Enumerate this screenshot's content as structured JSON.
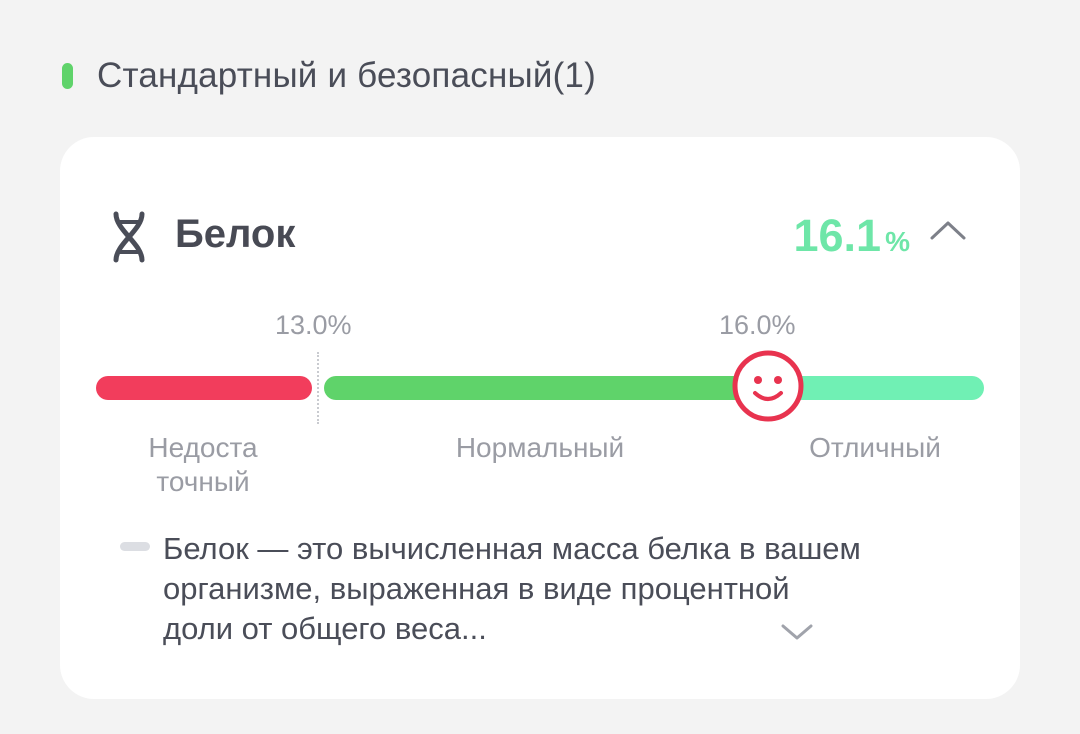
{
  "section": {
    "title": "Стандартный и безопасный(1)",
    "status_color": "#5fd36a"
  },
  "metric": {
    "icon": "dna-icon",
    "title": "Белок",
    "value": "16.1",
    "unit": "%",
    "value_color": "#6ee6a8",
    "toggle_icon": "chevron-up-icon"
  },
  "scale": {
    "thresholds": [
      "13.0%",
      "16.0%"
    ],
    "current_value": 16.1,
    "ranges": [
      {
        "label": "Недоста\nточный",
        "color": "#f23d5c"
      },
      {
        "label": "Нормальный",
        "color": "#5fd36a"
      },
      {
        "label": "Отличный",
        "color": "#70f0b4"
      }
    ],
    "indicator_icon": "smiley-icon",
    "indicator_color": "#e8334f"
  },
  "description": {
    "text": "Белок — это вычисленная масса белка в вашем организме, выраженная в виде процентной доли от общего веса...",
    "expand_icon": "chevron-down-icon"
  }
}
